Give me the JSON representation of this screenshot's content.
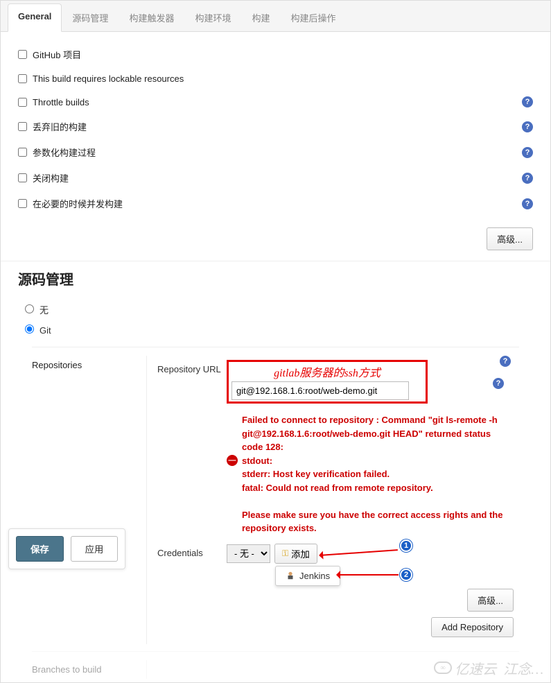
{
  "tabs": [
    {
      "label": "General",
      "active": true
    },
    {
      "label": "源码管理",
      "active": false
    },
    {
      "label": "构建触发器",
      "active": false
    },
    {
      "label": "构建环境",
      "active": false
    },
    {
      "label": "构建",
      "active": false
    },
    {
      "label": "构建后操作",
      "active": false
    }
  ],
  "general": {
    "options": [
      {
        "label": "GitHub 项目",
        "help": false
      },
      {
        "label": "This build requires lockable resources",
        "help": false
      },
      {
        "label": "Throttle builds",
        "help": true
      },
      {
        "label": "丢弃旧的构建",
        "help": true
      },
      {
        "label": "参数化构建过程",
        "help": true
      },
      {
        "label": "关闭构建",
        "help": true
      },
      {
        "label": "在必要的时候并发构建",
        "help": true
      }
    ],
    "advanced": "高级..."
  },
  "scm": {
    "title": "源码管理",
    "none": "无",
    "git": "Git",
    "repositories_label": "Repositories",
    "url_label": "Repository URL",
    "url_value": "git@192.168.1.6:root/web-demo.git",
    "annotation": "gitlab服务器的ssh方式",
    "error": "Failed to connect to repository : Command \"git ls-remote -h git@192.168.1.6:root/web-demo.git HEAD\" returned status code 128:\nstdout:\nstderr: Host key verification failed.\nfatal: Could not read from remote repository.\n\nPlease make sure you have the correct access rights and the repository exists.",
    "credentials_label": "Credentials",
    "credentials_value": "- 无 -",
    "add_label": "添加",
    "jenkins_label": "Jenkins",
    "advanced": "高级...",
    "add_repo": "Add Repository",
    "branches_label": "Branches to build"
  },
  "buttons": {
    "save": "保存",
    "apply": "应用"
  },
  "badges": {
    "one": "1",
    "two": "2"
  },
  "watermark": "江念…",
  "watermark_sub": "亿速云"
}
